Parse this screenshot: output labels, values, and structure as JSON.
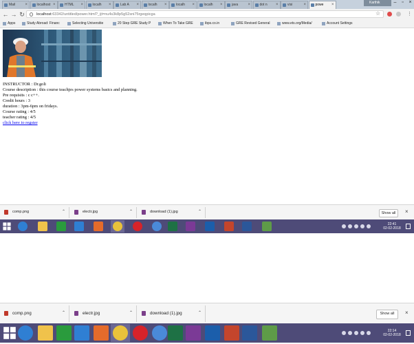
{
  "browser": {
    "tabs": [
      {
        "label": "Mail"
      },
      {
        "label": "localhost"
      },
      {
        "label": "HTML"
      },
      {
        "label": "localh"
      },
      {
        "label": "Lab A"
      },
      {
        "label": "localh"
      },
      {
        "label": "localh"
      },
      {
        "label": "localh"
      },
      {
        "label": "java"
      },
      {
        "label": "dot n"
      },
      {
        "label": "visi"
      },
      {
        "label": "powe",
        "active": true
      }
    ],
    "profile_name": "Karthik",
    "url_host": "localhost",
    "url_path": ":63342/untitled/power.html?_ijt=nu4s3k8p5g52sni75rgeqpicga",
    "bookmarks": [
      {
        "label": "Apps"
      },
      {
        "label": "Study Abroad: Financ"
      },
      {
        "label": "Selecting Universitie"
      },
      {
        "label": "20 Step GRE Study P"
      },
      {
        "label": "When To Take GRE"
      },
      {
        "label": "ibps.co.in"
      },
      {
        "label": "GRE Revised General"
      },
      {
        "label": "www.ets.org/Media/"
      },
      {
        "label": "Account Settings"
      }
    ]
  },
  "page": {
    "hero_alt": "worker",
    "lines": [
      "INSTRUCTOR : Dr.goli",
      "Course description : this course teachjes power systems basics and planning.",
      "Pre requisits : c c++.",
      "Credit hours : 3",
      "duration : 3pm-6pm on fridays.",
      "Course rating : 4/5",
      "teacher rating : 4/5"
    ],
    "register_link": "click here to regster"
  },
  "downloads": {
    "items": [
      {
        "name": "comp.png",
        "color": "#c0392b"
      },
      {
        "name": "electr.jpg",
        "color": "#7b3f8a"
      },
      {
        "name": "download (1).jpg",
        "color": "#7b3f8a"
      }
    ],
    "show_all": "Show all"
  },
  "taskbar_top": {
    "time": "22:41",
    "date": "02-02-2018"
  },
  "taskbar_bottom": {
    "time": "22:14",
    "date": "02-02-2018"
  },
  "taskbar_apps": [
    {
      "icon": "start-icon",
      "color": "#ffffff"
    },
    {
      "icon": "edge-icon",
      "color": "#2f7fd3"
    },
    {
      "icon": "file-explorer-icon",
      "color": "#f0c24b"
    },
    {
      "icon": "store-icon",
      "color": "#2a9b3d"
    },
    {
      "icon": "dropbox-icon",
      "color": "#2f7fd3"
    },
    {
      "icon": "photos-icon",
      "color": "#e56b2b"
    },
    {
      "icon": "chrome-icon",
      "color": "#e9c23b"
    },
    {
      "icon": "opera-icon",
      "color": "#d6232a"
    },
    {
      "icon": "chromium-icon",
      "color": "#4a8ad9"
    },
    {
      "icon": "excel-icon",
      "color": "#1e7145"
    },
    {
      "icon": "onenote-icon",
      "color": "#7b3a96"
    },
    {
      "icon": "outlook-icon",
      "color": "#1b5eab"
    },
    {
      "icon": "powerpoint-icon",
      "color": "#c4452c"
    },
    {
      "icon": "word-icon",
      "color": "#2b579a"
    },
    {
      "icon": "visual-studio-icon",
      "color": "#5e9b48"
    }
  ]
}
